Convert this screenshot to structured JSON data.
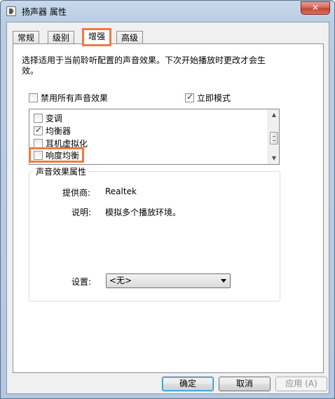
{
  "window": {
    "title": "扬声器 属性",
    "close_glyph": "✕"
  },
  "tabs": [
    {
      "label": "常规"
    },
    {
      "label": "级别"
    },
    {
      "label": "增强"
    },
    {
      "label": "高级"
    }
  ],
  "enhancements": {
    "description": "选择适用于当前聆听配置的声音效果。下次开始播放时更改才会生效。",
    "disable_all": {
      "label": "禁用所有声音效果",
      "checked": false
    },
    "immediate_mode": {
      "label": "立即模式",
      "checked": true
    },
    "effects": [
      {
        "label": "变调",
        "checked": false
      },
      {
        "label": "均衡器",
        "checked": true
      },
      {
        "label": "耳机虚拟化",
        "checked": false
      },
      {
        "label": "响度均衡",
        "checked": false
      }
    ]
  },
  "properties": {
    "title": "声音效果属性",
    "provider_label": "提供商:",
    "provider_value": "Realtek",
    "description_label": "说明:",
    "description_value": "模拟多个播放环境。",
    "settings_label": "设置:",
    "settings_value": "<无>"
  },
  "buttons": {
    "ok": "确定",
    "cancel": "取消",
    "apply": "应用 (A)"
  },
  "colors": {
    "highlight": "#f07a42",
    "title_bar": "#b9cde5",
    "close_button": "#c44536"
  }
}
